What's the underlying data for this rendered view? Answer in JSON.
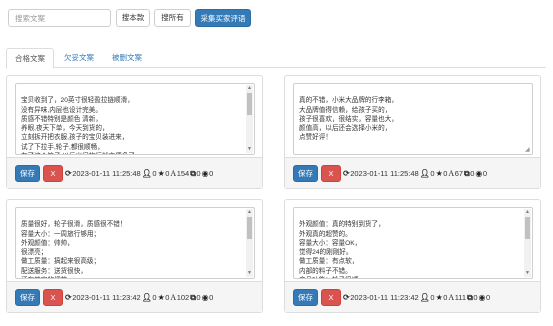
{
  "toolbar": {
    "search_placeholder": "搜索文案",
    "btn_this_item": "搜本款",
    "btn_all": "搜所有",
    "btn_collect": "采集买家评语"
  },
  "tabs": [
    {
      "label": "合格文案",
      "active": true
    },
    {
      "label": "欠妥文案",
      "active": false
    },
    {
      "label": "被删文案",
      "active": false
    }
  ],
  "cards": [
    {
      "text": "宝贝收到了，20英寸很轻盈拉链顺滑，\n没有异味,内层也设计完美。\n质感不错特别是颜色 清新，\n养眼,夜天下单，今天到货的，\n立刻拆开把衣服,孩子的宝贝装进来，\n试了下拉手,轮子,都很顺畅，\n有了这个箱子,以后出门旅行就方便多了",
      "save": "保存",
      "del": "X",
      "datetime": "2023-01-11 11:25:48",
      "likes": "0",
      "stars": "0",
      "length": "154",
      "copies": "0",
      "views": "0",
      "has_scroll": true
    },
    {
      "text": "真的不错，小米大品牌的行李箱，\n大品牌值得信赖，给孩子买的，\n孩子很喜欢，很结实，容量也大，\n颜值高，以后还会选择小米的，\n点赞好评！",
      "save": "保存",
      "del": "X",
      "datetime": "2023-01-11 11:25:48",
      "likes": "0",
      "stars": "0",
      "length": "67",
      "copies": "0",
      "views": "0",
      "has_scroll": false
    },
    {
      "text": "质量很好，轮子很滑，质感很不错！\n容量大小：一周旅行够用；\n外观颜值：帅帅，\n很漂亮；\n做工质量：搞起来很高级；\n配送服务：送货很快，\n还有其它的细节",
      "save": "保存",
      "del": "X",
      "datetime": "2023-01-11 11:23:42",
      "likes": "0",
      "stars": "0",
      "length": "102",
      "copies": "0",
      "views": "0",
      "has_scroll": true
    },
    {
      "text": "外观颜值：真的特别到货了，\n外观真的超赞的。\n容量大小：容量OK，\n觉得24的刚刚好。\n做工质量：有点软，\n内部的料子不错。\n产品功能：轮子很顺",
      "save": "保存",
      "del": "X",
      "datetime": "2023-01-11 11:23:42",
      "likes": "0",
      "stars": "0",
      "length": "111",
      "copies": "0",
      "views": "0",
      "has_scroll": true
    }
  ],
  "icons": {
    "refresh": "refresh-icon",
    "user": "user-icon",
    "star": "star-icon",
    "font": "font-size-icon",
    "copy": "copy-icon",
    "eye": "eye-icon"
  },
  "colors": {
    "primary": "#337ab7",
    "danger": "#d9534f",
    "footer_bg": "#f5f5f5"
  }
}
